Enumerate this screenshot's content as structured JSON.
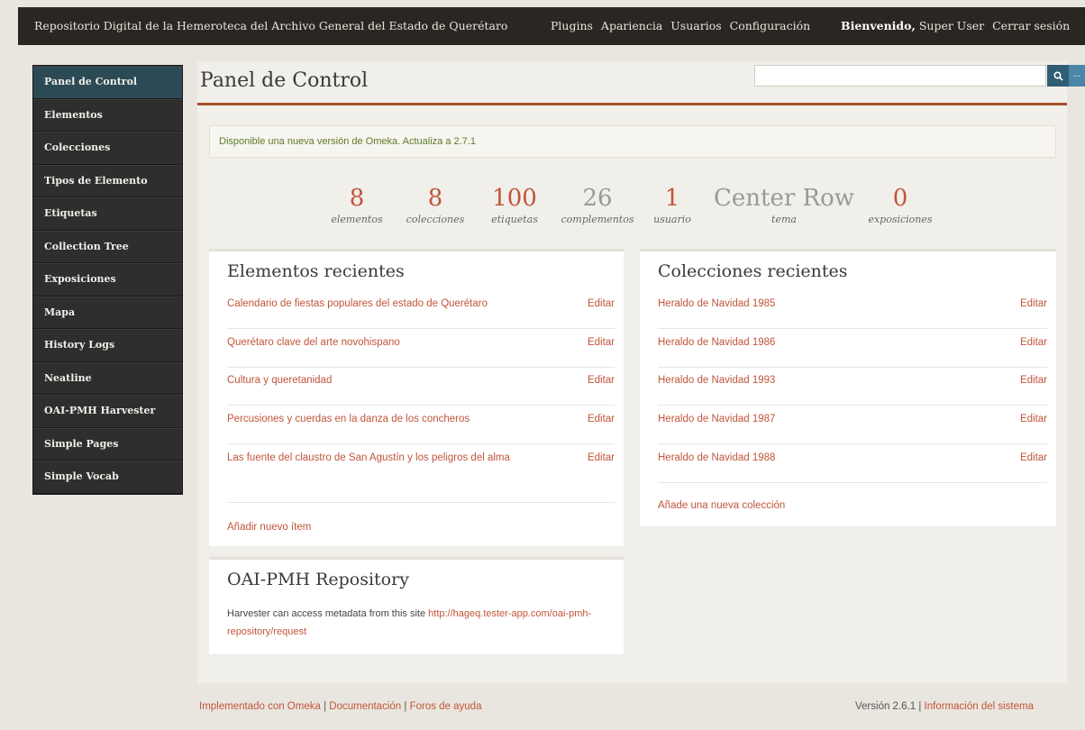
{
  "topbar": {
    "site_title": "Repositorio Digital de la Hemeroteca del Archivo General del Estado de Querétaro",
    "nav": [
      "Plugins",
      "Apariencia",
      "Usuarios",
      "Configuración"
    ],
    "welcome_label": "Bienvenido,",
    "user_name": "Super User",
    "logout": "Cerrar sesión"
  },
  "sidebar": {
    "items": [
      {
        "label": "Panel de Control",
        "active": true
      },
      {
        "label": "Elementos"
      },
      {
        "label": "Colecciones"
      },
      {
        "label": "Tipos de Elemento"
      },
      {
        "label": "Etiquetas"
      },
      {
        "label": "Collection Tree"
      },
      {
        "label": "Exposiciones"
      },
      {
        "label": "Mapa"
      },
      {
        "label": "History Logs"
      },
      {
        "label": "Neatline"
      },
      {
        "label": "OAI-PMH Harvester"
      },
      {
        "label": "Simple Pages"
      },
      {
        "label": "Simple Vocab"
      }
    ]
  },
  "page": {
    "title": "Panel de Control",
    "search": {
      "value": "",
      "button_icon": "search-icon",
      "advanced_label": "..."
    }
  },
  "notice": {
    "text": "Disponible una nueva versión de Omeka. Actualiza a 2.7.1"
  },
  "stats": [
    {
      "value": "8",
      "label": "elementos"
    },
    {
      "value": "8",
      "label": "colecciones"
    },
    {
      "value": "100",
      "label": "etiquetas"
    },
    {
      "value": "26",
      "label": "complementos"
    },
    {
      "value": "1",
      "label": "usuario"
    },
    {
      "value": "Center Row",
      "label": "tema"
    },
    {
      "value": "0",
      "label": "exposiciones"
    }
  ],
  "recent_items": {
    "title": "Elementos recientes",
    "edit_label": "Editar",
    "rows": [
      "Calendario de fiestas populares del estado de Querétaro",
      "Querétaro clave del arte novohispano",
      "Cultura y queretanidad",
      "Percusiones y cuerdas en la danza de los concheros",
      "Las fuente del claustro de San Agustín y los peligros del alma"
    ],
    "add_label": "Añadir nuevo ítem"
  },
  "recent_collections": {
    "title": "Colecciones recientes",
    "edit_label": "Editar",
    "rows": [
      "Heraldo de Navidad 1985",
      "Heraldo de Navidad 1986",
      "Heraldo de Navidad 1993",
      "Heraldo de Navidad 1987",
      "Heraldo de Navidad 1988"
    ],
    "add_label": "Añade una nueva colección"
  },
  "oai": {
    "title": "OAI-PMH Repository",
    "text": "Harvester can access metadata from this site",
    "url": "http://hageq.tester-app.com/oai-pmh-repository/request"
  },
  "footer": {
    "links": [
      "Implementado con Omeka",
      "Documentación",
      "Foros de ayuda"
    ],
    "version": "Versión 2.6.1",
    "info": "Información del sistema"
  }
}
